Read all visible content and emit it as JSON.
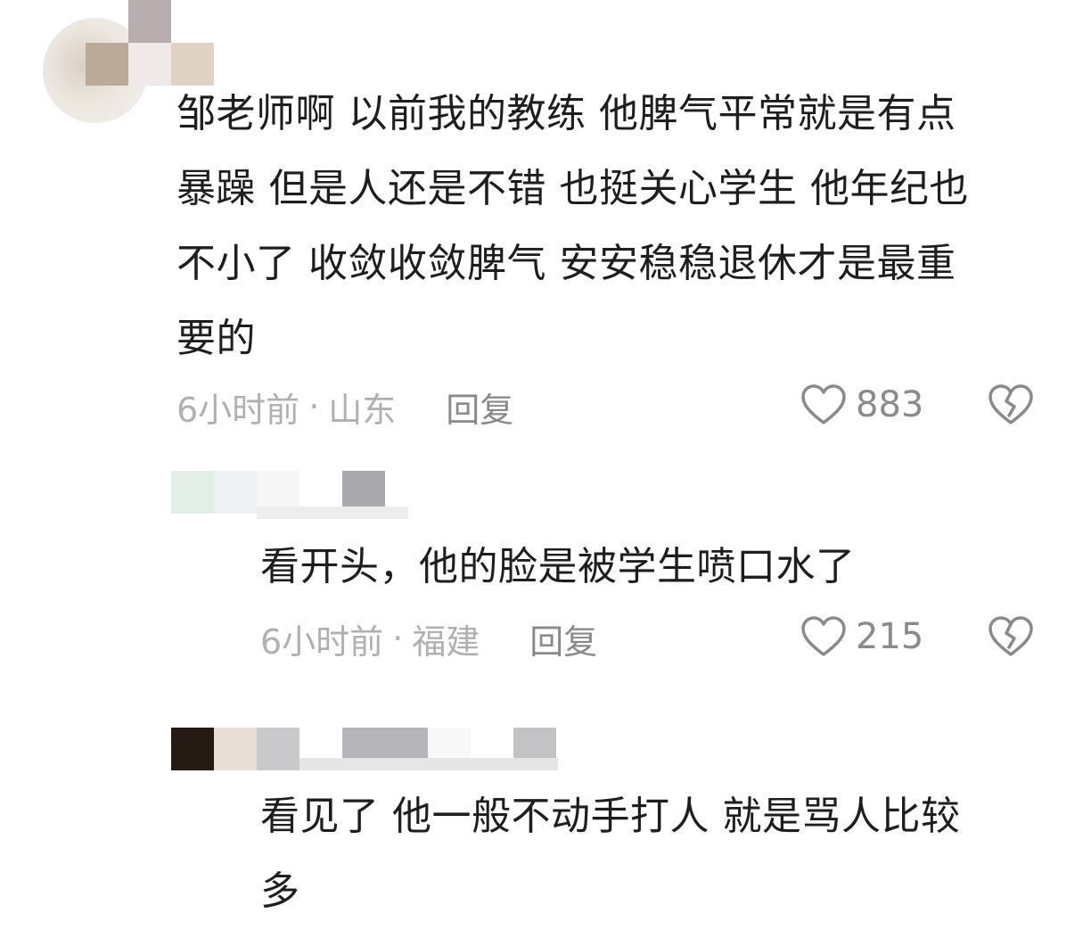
{
  "comments": [
    {
      "text": "邹老师啊 以前我的教练 他脾气平常就是有点\n暴躁 但是人还是不错 也挺关心学生 他年纪也\n不小了 收敛收敛脾气 安安稳稳退休才是最重\n要的",
      "time": "6小时前",
      "dot": "·",
      "location": "山东",
      "reply_label": "回复",
      "likes": "883"
    },
    {
      "text": "看开头，他的脸是被学生喷口水了",
      "time": "6小时前",
      "dot": "·",
      "location": "福建",
      "reply_label": "回复",
      "likes": "215"
    },
    {
      "text": "看见了 他一般不动手打人 就是骂人比较\n多"
    }
  ],
  "icons": {
    "like": "heart-outline-icon",
    "dislike": "broken-heart-icon"
  },
  "colors": {
    "text": "#1e1e1e",
    "meta": "#b0b0b0",
    "action": "#8a8a8a"
  }
}
